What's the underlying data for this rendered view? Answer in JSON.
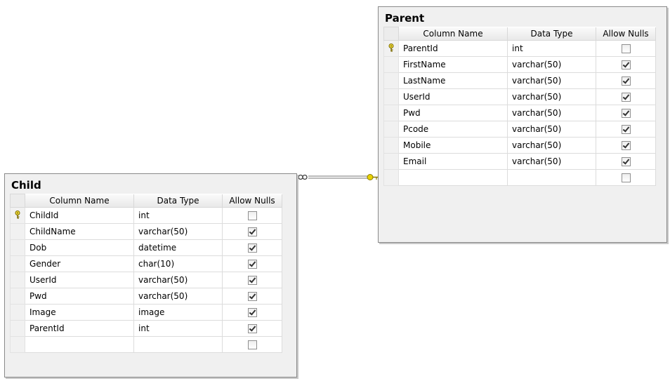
{
  "columns_header": [
    "Column Name",
    "Data Type",
    "Allow Nulls"
  ],
  "parent": {
    "title": "Parent",
    "rows": [
      {
        "name": "ParentId",
        "type": "int",
        "nulls": false,
        "pk": true
      },
      {
        "name": "FirstName",
        "type": "varchar(50)",
        "nulls": true,
        "pk": false
      },
      {
        "name": "LastName",
        "type": "varchar(50)",
        "nulls": true,
        "pk": false
      },
      {
        "name": "UserId",
        "type": "varchar(50)",
        "nulls": true,
        "pk": false
      },
      {
        "name": "Pwd",
        "type": "varchar(50)",
        "nulls": true,
        "pk": false
      },
      {
        "name": "Pcode",
        "type": "varchar(50)",
        "nulls": true,
        "pk": false
      },
      {
        "name": "Mobile",
        "type": "varchar(50)",
        "nulls": true,
        "pk": false
      },
      {
        "name": "Email",
        "type": "varchar(50)",
        "nulls": true,
        "pk": false
      },
      {
        "name": "",
        "type": "",
        "nulls": false,
        "pk": false
      }
    ]
  },
  "child": {
    "title": "Child",
    "rows": [
      {
        "name": "ChildId",
        "type": "int",
        "nulls": false,
        "pk": true
      },
      {
        "name": "ChildName",
        "type": "varchar(50)",
        "nulls": true,
        "pk": false
      },
      {
        "name": "Dob",
        "type": "datetime",
        "nulls": true,
        "pk": false
      },
      {
        "name": "Gender",
        "type": "char(10)",
        "nulls": true,
        "pk": false
      },
      {
        "name": "UserId",
        "type": "varchar(50)",
        "nulls": true,
        "pk": false
      },
      {
        "name": "Pwd",
        "type": "varchar(50)",
        "nulls": true,
        "pk": false
      },
      {
        "name": "Image",
        "type": "image",
        "nulls": true,
        "pk": false
      },
      {
        "name": "ParentId",
        "type": "int",
        "nulls": true,
        "pk": false
      },
      {
        "name": "",
        "type": "",
        "nulls": false,
        "pk": false
      }
    ]
  },
  "relationship": {
    "from": "Child",
    "to": "Parent",
    "from_end": "infinity",
    "to_end": "key"
  },
  "colors": {
    "box_bg": "#f0f0f0",
    "border": "#8a8a8a",
    "key_icon": "#d4b000"
  }
}
